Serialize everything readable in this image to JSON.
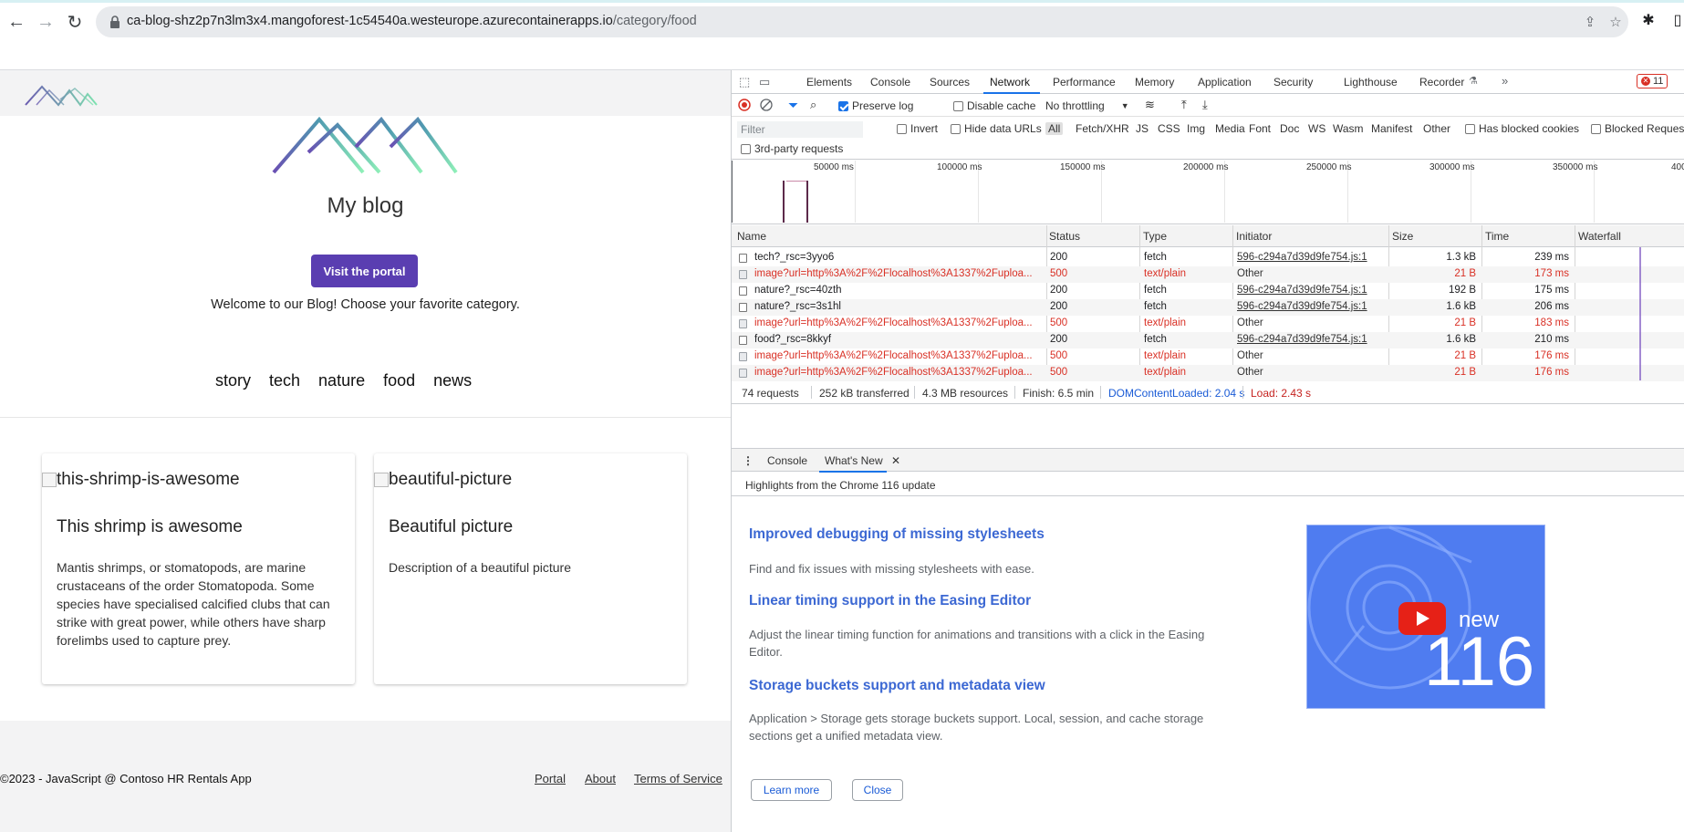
{
  "browser": {
    "url_host": "ca-blog-shz2p7n3lm3x4.mangoforest-1c54540a.westeurope.azurecontainerapps.io",
    "url_path": "/category/food"
  },
  "blog": {
    "title": "My blog",
    "portal_button": "Visit the portal",
    "welcome": "Welcome to our Blog! Choose your favorite category.",
    "categories": [
      "story",
      "tech",
      "nature",
      "food",
      "news"
    ],
    "cards": [
      {
        "image_alt": "this-shrimp-is-awesome",
        "title": "This shrimp is awesome",
        "description": "Mantis shrimps, or stomatopods, are marine crustaceans of the order Stomatopoda. Some species have specialised calcified clubs that can strike with great power, while others have sharp forelimbs used to capture prey."
      },
      {
        "image_alt": "beautiful-picture",
        "title": "Beautiful picture",
        "description": "Description of a beautiful picture"
      }
    ],
    "footer": {
      "copyright": "©2023 - JavaScript @ Contoso HR Rentals App",
      "links": [
        "Portal",
        "About",
        "Terms of Service"
      ]
    }
  },
  "devtools": {
    "tabs": [
      "Elements",
      "Console",
      "Sources",
      "Network",
      "Performance",
      "Memory",
      "Application",
      "Security",
      "Lighthouse",
      "Recorder"
    ],
    "active_tab": "Network",
    "error_count": "11",
    "toolbar": {
      "preserve_log": "Preserve log",
      "disable_cache": "Disable cache",
      "throttling": "No throttling"
    },
    "filter": {
      "placeholder": "Filter",
      "invert": "Invert",
      "hide_data_urls": "Hide data URLs",
      "types": [
        "All",
        "Fetch/XHR",
        "JS",
        "CSS",
        "Img",
        "Media",
        "Font",
        "Doc",
        "WS",
        "Wasm",
        "Manifest",
        "Other"
      ],
      "has_blocked_cookies": "Has blocked cookies",
      "blocked_requests": "Blocked Requests",
      "third_party": "3rd-party requests"
    },
    "overview_ticks": [
      "50000 ms",
      "100000 ms",
      "150000 ms",
      "200000 ms",
      "250000 ms",
      "300000 ms",
      "350000 ms",
      "400"
    ],
    "columns": [
      "Name",
      "Status",
      "Type",
      "Initiator",
      "Size",
      "Time",
      "Waterfall"
    ],
    "requests": [
      {
        "name": "tech?_rsc=3yyo6",
        "status": "200",
        "type": "fetch",
        "initiator": "596-c294a7d39d9fe754.js:1",
        "size": "1.3 kB",
        "time": "239 ms",
        "error": false
      },
      {
        "name": "image?url=http%3A%2F%2Flocalhost%3A1337%2Fuploa...",
        "status": "500",
        "type": "text/plain",
        "initiator": "Other",
        "size": "21 B",
        "time": "173 ms",
        "error": true
      },
      {
        "name": "nature?_rsc=40zth",
        "status": "200",
        "type": "fetch",
        "initiator": "596-c294a7d39d9fe754.js:1",
        "size": "192 B",
        "time": "175 ms",
        "error": false
      },
      {
        "name": "nature?_rsc=3s1hl",
        "status": "200",
        "type": "fetch",
        "initiator": "596-c294a7d39d9fe754.js:1",
        "size": "1.6 kB",
        "time": "206 ms",
        "error": false
      },
      {
        "name": "image?url=http%3A%2F%2Flocalhost%3A1337%2Fuploa...",
        "status": "500",
        "type": "text/plain",
        "initiator": "Other",
        "size": "21 B",
        "time": "183 ms",
        "error": true
      },
      {
        "name": "food?_rsc=8kkyf",
        "status": "200",
        "type": "fetch",
        "initiator": "596-c294a7d39d9fe754.js:1",
        "size": "1.6 kB",
        "time": "210 ms",
        "error": false
      },
      {
        "name": "image?url=http%3A%2F%2Flocalhost%3A1337%2Fuploa...",
        "status": "500",
        "type": "text/plain",
        "initiator": "Other",
        "size": "21 B",
        "time": "176 ms",
        "error": true
      },
      {
        "name": "image?url=http%3A%2F%2Flocalhost%3A1337%2Fuploa...",
        "status": "500",
        "type": "text/plain",
        "initiator": "Other",
        "size": "21 B",
        "time": "176 ms",
        "error": true
      }
    ],
    "summary": {
      "requests": "74 requests",
      "transferred": "252 kB transferred",
      "resources": "4.3 MB resources",
      "finish": "Finish: 6.5 min",
      "dom_content_loaded": "DOMContentLoaded: 2.04 s",
      "load": "Load: 2.43 s"
    },
    "drawer": {
      "tabs": [
        "Console",
        "What's New"
      ],
      "active": "What's New",
      "highlights": "Highlights from the Chrome 116 update",
      "items": [
        {
          "title": "Improved debugging of missing stylesheets",
          "desc": "Find and fix issues with missing stylesheets with ease."
        },
        {
          "title": "Linear timing support in the Easing Editor",
          "desc": "Adjust the linear timing function for animations and transitions with a click in the Easing Editor."
        },
        {
          "title": "Storage buckets support and metadata view",
          "desc": "Application > Storage gets storage buckets support. Local, session, and cache storage sections get a unified metadata view."
        }
      ],
      "video": {
        "label": "new",
        "version": "116"
      },
      "learn_more": "Learn more",
      "close": "Close"
    }
  }
}
